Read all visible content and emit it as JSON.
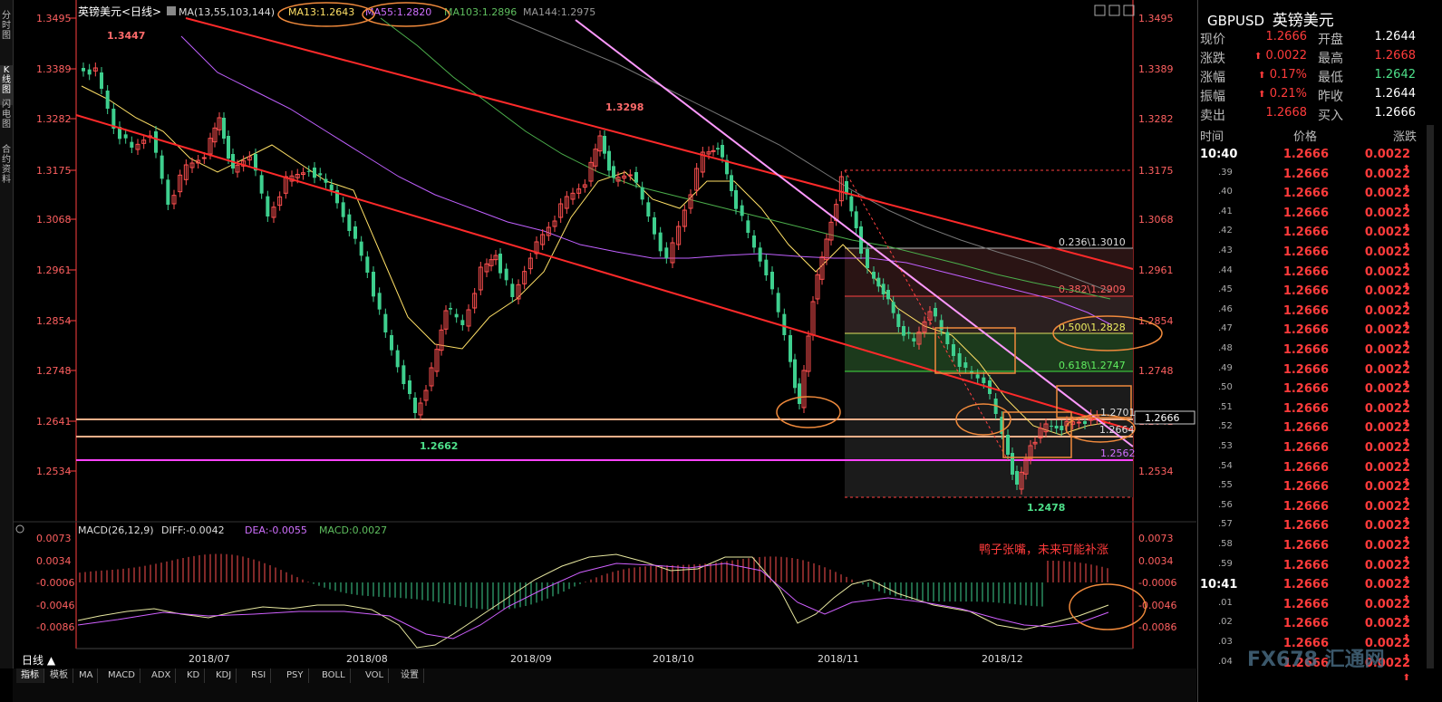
{
  "left_tabs": [
    "分时图",
    "K线图",
    "闪电图",
    "合约资料"
  ],
  "chart": {
    "title": "英镑美元<日线>",
    "ma_indicator": {
      "label": "MA(13,55,103,144)",
      "ma13": "MA13:1.2643",
      "ma55": "MA55:1.2820",
      "ma103": "MA103:1.2896",
      "ma144": "MA144:1.2975"
    },
    "price_ticks": [
      "1.3495",
      "1.3389",
      "1.3282",
      "1.3175",
      "1.3068",
      "1.2961",
      "1.2854",
      "1.2748",
      "1.2641",
      "1.2534"
    ],
    "peak_labels": {
      "high_1": "1.3447",
      "high_2": "1.3298",
      "low_1": "1.2662",
      "low_2": "1.2478"
    },
    "fib": [
      {
        "label": "0.236\\1.3010"
      },
      {
        "label": "0.382\\1.2909"
      },
      {
        "label": "0.500\\1.2828"
      },
      {
        "label": "0.618\\1.2747"
      }
    ],
    "annotations": {
      "level_1": "1.2701",
      "level_2": "1.2664",
      "level_3": "1.2562",
      "current_price": "1.2666"
    },
    "macd": {
      "label": "MACD(26,12,9)",
      "diff": "DIFF:-0.0042",
      "dea": "DEA:-0.0055",
      "macd": "MACD:0.0027",
      "ticks": [
        "0.0073",
        "0.0034",
        "-0.0006",
        "-0.0046",
        "-0.0086"
      ],
      "note": "鸭子张嘴，未来可能补涨"
    },
    "x_labels": [
      "2018/07",
      "2018/08",
      "2018/09",
      "2018/10",
      "2018/11",
      "2018/12"
    ],
    "period_button": "日线 ▲"
  },
  "bottom_tabs": [
    "指标",
    "模板",
    "MA",
    "MACD",
    "ADX",
    "KD",
    "KDJ",
    "RSI",
    "PSY",
    "BOLL",
    "VOL",
    "设置"
  ],
  "quote": {
    "symbol": "GBPUSD",
    "name": "英镑美元",
    "rows": [
      {
        "l1": "现价",
        "v1": "1.2666",
        "l2": "开盘",
        "v2": "1.2644"
      },
      {
        "l1": "涨跌",
        "v1": "0.0022",
        "l2": "最高",
        "v2": "1.2668"
      },
      {
        "l1": "涨幅",
        "v1": "0.17%",
        "l2": "最低",
        "v2": "1.2642"
      },
      {
        "l1": "振幅",
        "v1": "0.21%",
        "l2": "昨收",
        "v2": "1.2644"
      },
      {
        "l1": "卖出",
        "v1": "1.2668",
        "l2": "买入",
        "v2": "1.2666"
      }
    ],
    "tick_headers": [
      "时间",
      "价格",
      "涨跌"
    ],
    "ticks": [
      {
        "t": "10:40",
        "p": "1.2666",
        "c": "0.0022"
      },
      {
        "t": ".39",
        "p": "1.2666",
        "c": "0.0022"
      },
      {
        "t": ".40",
        "p": "1.2666",
        "c": "0.0022"
      },
      {
        "t": ".41",
        "p": "1.2666",
        "c": "0.0022"
      },
      {
        "t": ".42",
        "p": "1.2666",
        "c": "0.0022"
      },
      {
        "t": ".43",
        "p": "1.2666",
        "c": "0.0022"
      },
      {
        "t": ".44",
        "p": "1.2666",
        "c": "0.0022"
      },
      {
        "t": ".45",
        "p": "1.2666",
        "c": "0.0022"
      },
      {
        "t": ".46",
        "p": "1.2666",
        "c": "0.0022"
      },
      {
        "t": ".47",
        "p": "1.2666",
        "c": "0.0022"
      },
      {
        "t": ".48",
        "p": "1.2666",
        "c": "0.0022"
      },
      {
        "t": ".49",
        "p": "1.2666",
        "c": "0.0022"
      },
      {
        "t": ".50",
        "p": "1.2666",
        "c": "0.0022"
      },
      {
        "t": ".51",
        "p": "1.2666",
        "c": "0.0022"
      },
      {
        "t": ".52",
        "p": "1.2666",
        "c": "0.0022"
      },
      {
        "t": ".53",
        "p": "1.2666",
        "c": "0.0022"
      },
      {
        "t": ".54",
        "p": "1.2666",
        "c": "0.0022"
      },
      {
        "t": ".55",
        "p": "1.2666",
        "c": "0.0022"
      },
      {
        "t": ".56",
        "p": "1.2666",
        "c": "0.0022"
      },
      {
        "t": ".57",
        "p": "1.2666",
        "c": "0.0022"
      },
      {
        "t": ".58",
        "p": "1.2666",
        "c": "0.0022"
      },
      {
        "t": ".59",
        "p": "1.2666",
        "c": "0.0022"
      },
      {
        "t": "10:41",
        "p": "1.2666",
        "c": "0.0022"
      },
      {
        "t": ".01",
        "p": "1.2666",
        "c": "0.0022"
      },
      {
        "t": ".02",
        "p": "1.2666",
        "c": "0.0022"
      },
      {
        "t": ".03",
        "p": "1.2666",
        "c": "0.0022"
      },
      {
        "t": ".04",
        "p": "1.2666",
        "c": "0.0022"
      }
    ]
  },
  "watermark": "FX678 汇通网",
  "colors": {
    "up": "#ff3b3b",
    "down": "#3ecf8e",
    "trend": "#ff2a2a",
    "pink": "#ff99ff",
    "orange": "#f08a3c"
  }
}
